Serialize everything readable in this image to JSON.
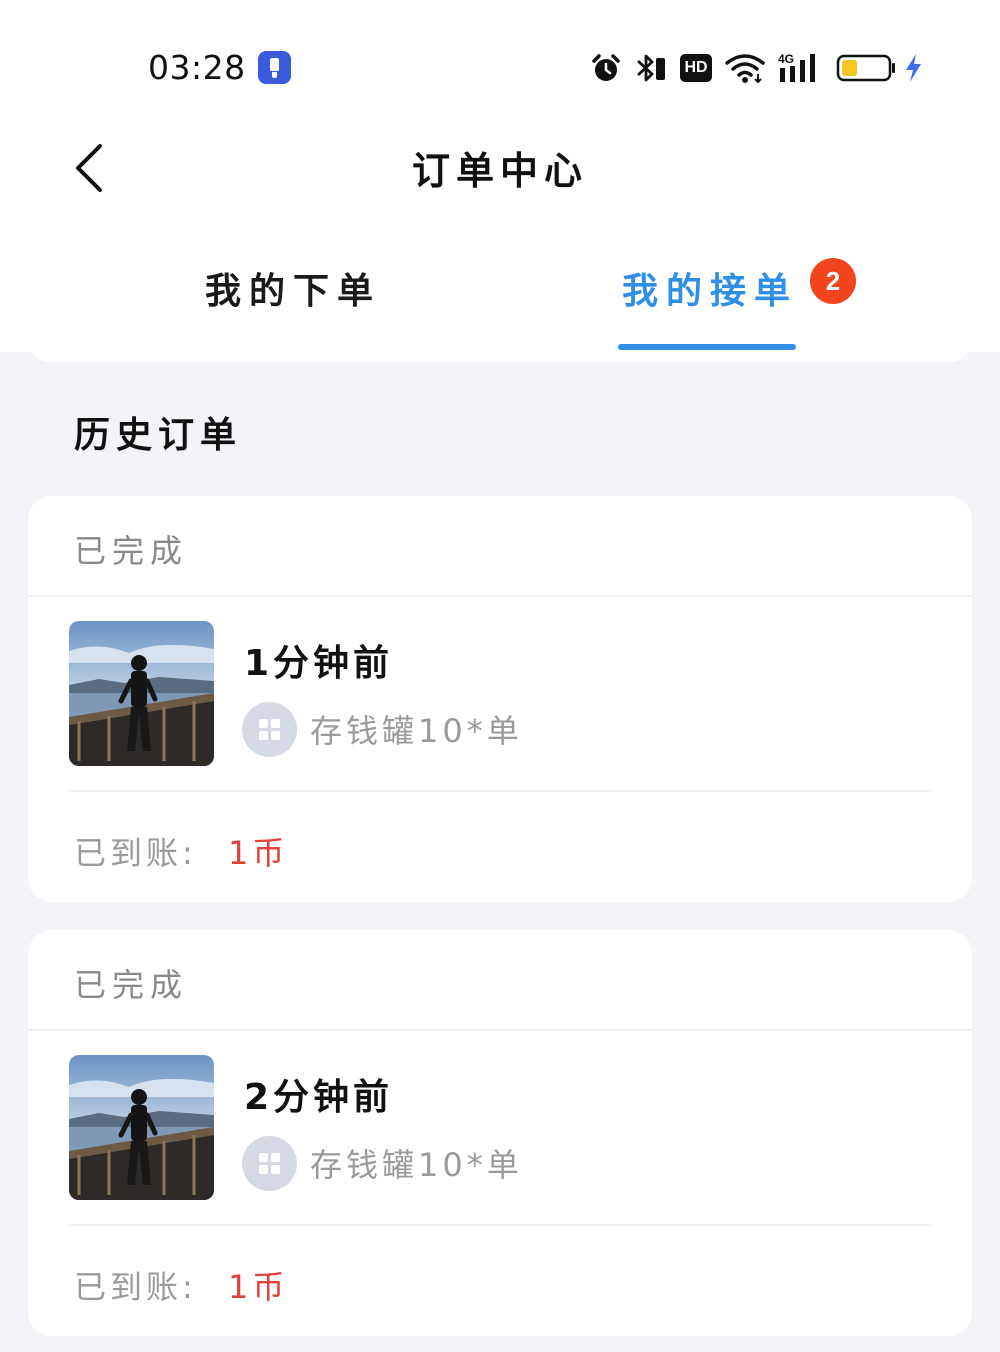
{
  "status_bar": {
    "time": "03:28",
    "hd_label": "HD",
    "network_label": "4G",
    "icons": [
      "flashlight-app-icon",
      "alarm-icon",
      "bluetooth-icon",
      "hd-icon",
      "wifi-icon",
      "signal-icon",
      "battery-icon",
      "charging-icon"
    ],
    "battery_level": 0.35
  },
  "header": {
    "title": "订单中心",
    "back_icon": "chevron-left-icon"
  },
  "tabs": [
    {
      "label": "我的下单",
      "active": false
    },
    {
      "label": "我的接单",
      "active": true,
      "badge": "2"
    }
  ],
  "colors": {
    "accent": "#2f8ee6",
    "badge": "#f2451d",
    "amount": "#e0403a",
    "background": "#f3f4f7"
  },
  "section_title": "历史订单",
  "orders": [
    {
      "status": "已完成",
      "time_ago": "1分钟前",
      "item": "存钱罐10*单",
      "paid_label": "已到账:",
      "paid_value": "1币"
    },
    {
      "status": "已完成",
      "time_ago": "2分钟前",
      "item": "存钱罐10*单",
      "paid_label": "已到账:",
      "paid_value": "1币"
    }
  ]
}
